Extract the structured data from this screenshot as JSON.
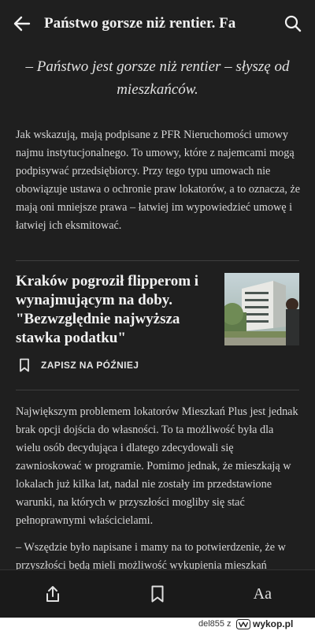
{
  "header": {
    "title": "Państwo gorsze niż rentier. Fa",
    "back_icon": "arrow-left-icon",
    "search_icon": "search-icon"
  },
  "article": {
    "quote": "– Państwo jest gorsze niż rentier – słyszę od mieszkańców.",
    "paragraph1": "Jak wskazują, mają podpisane z PFR Nieruchomości umowy najmu instytucjonalnego. To umowy, które z najemcami mogą podpisywać przedsiębiorcy. Przy tego typu umowach nie obowiązuje ustawa o ochronie praw lokatorów, a to oznacza, że mają oni mniejsze prawa – łatwiej im wypowiedzieć umowę i łatwiej ich eksmitować.",
    "related": {
      "title": "Kraków pogroził flipperom i wynajmującym na doby. \"Bezwzględnie najwyższa stawka podatku\"",
      "save_label": "ZAPISZ NA PÓŹNIEJ"
    },
    "paragraph2": "Największym problemem lokatorów Mieszkań Plus jest jednak brak opcji dojścia do własności. To ta możliwość była dla wielu osób decydująca i dlatego zdecydowali się zawnioskować w programie. Pomimo jednak, że mieszkają w lokalach już kilka lat, nadal nie zostały im przedstawione warunki, na których w przyszłości mogliby się stać pełnoprawnymi właścicielami.",
    "paragraph3": "– Wszędzie było napisane i mamy na to potwierdzenie, że w przyszłości będą mieli możliwość wykupienia mieszkań"
  },
  "toolbar": {
    "share_icon": "share-icon",
    "bookmark_icon": "bookmark-icon",
    "text_size_label": "Aa"
  },
  "watermark": {
    "user": "del855",
    "z": "z",
    "site": "wykop.pl"
  }
}
